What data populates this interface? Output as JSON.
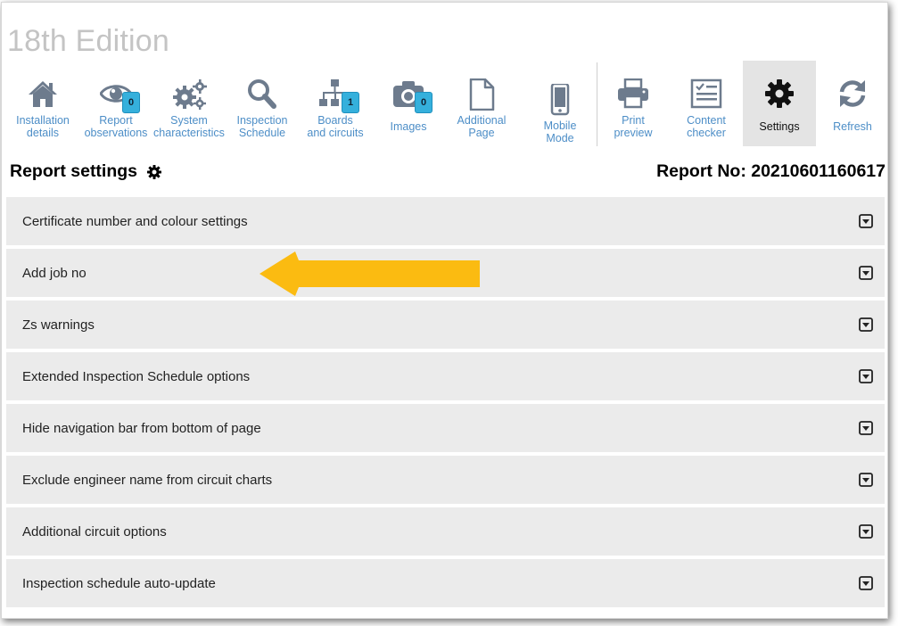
{
  "app": {
    "title": "18th Edition"
  },
  "toolbar": {
    "items": [
      {
        "key": "installation",
        "label": "Installation\ndetails",
        "icon": "home-icon"
      },
      {
        "key": "observations",
        "label": "Report\nobservations",
        "icon": "eye-icon",
        "badge": "0"
      },
      {
        "key": "system",
        "label": "System\ncharacteristics",
        "icon": "gears-icon"
      },
      {
        "key": "inspection",
        "label": "Inspection\nSchedule",
        "icon": "search-icon"
      },
      {
        "key": "boards",
        "label": "Boards\nand circuits",
        "icon": "sitemap-icon",
        "badge": "1"
      },
      {
        "key": "images",
        "label": "Images",
        "icon": "camera-icon",
        "badge": "0"
      },
      {
        "key": "additional",
        "label": "Additional\nPage",
        "icon": "file-icon"
      },
      {
        "key": "mobile",
        "label": "Mobile\nMode",
        "icon": "mobile-icon"
      },
      {
        "key": "print",
        "label": "Print\npreview",
        "icon": "printer-icon"
      },
      {
        "key": "checker",
        "label": "Content\nchecker",
        "icon": "checklist-icon"
      },
      {
        "key": "settings",
        "label": "Settings",
        "icon": "gear-icon",
        "active": true
      },
      {
        "key": "refresh",
        "label": "Refresh",
        "icon": "refresh-icon"
      }
    ]
  },
  "page": {
    "title": "Report settings",
    "report_no": "Report No: 20210601160617"
  },
  "settings": {
    "rows": [
      "Certificate number and colour settings",
      "Add job no",
      "Zs warnings",
      "Extended Inspection Schedule options",
      "Hide navigation bar from bottom of page",
      "Exclude engineer name from circuit charts",
      "Additional circuit options",
      "Inspection schedule auto-update"
    ]
  },
  "colors": {
    "icon": "#6d7b8d",
    "label": "#4d8ec7",
    "badge": "#35b0dc",
    "row_bg": "#ebebeb",
    "arrow": "#fbbb11"
  }
}
